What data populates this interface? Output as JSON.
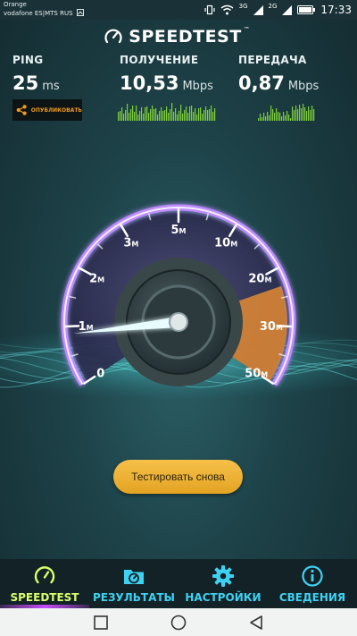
{
  "status_bar": {
    "carrier1": "Orange",
    "carrier2": "vodafone ES|MTS RUS",
    "net1": "3G",
    "net2": "2G",
    "time": "17:33"
  },
  "header": {
    "title": "SPEEDTEST",
    "tm": "™"
  },
  "metrics": {
    "ping": {
      "label": "PING",
      "value": "25",
      "unit": "ms"
    },
    "download": {
      "label": "ПОЛУЧЕНИЕ",
      "value": "10,53",
      "unit": "Mbps"
    },
    "upload": {
      "label": "ПЕРЕДАЧА",
      "value": "0,87",
      "unit": "Mbps"
    }
  },
  "share_button": {
    "label": "ОПУБЛИКОВАТЬ",
    "accent": "#f29b1c"
  },
  "gauge": {
    "ticks": [
      "0",
      "1M",
      "2M",
      "3M",
      "5M",
      "10M",
      "20M",
      "30M",
      "50M"
    ],
    "needle_value_mbps": 0.87,
    "colors": {
      "ring": "#bd8cff",
      "accent": "#e38a33",
      "tick": "#ffffff"
    }
  },
  "test_again_button": {
    "label": "Тестировать снова",
    "color": "#f0b536"
  },
  "nav": {
    "items": [
      {
        "label": "SPEEDTEST",
        "icon": "gauge-icon"
      },
      {
        "label": "РЕЗУЛЬТАТЫ",
        "icon": "results-folder-icon"
      },
      {
        "label": "НАСТРОЙКИ",
        "icon": "gear-icon"
      },
      {
        "label": "СВЕДЕНИЯ",
        "icon": "info-icon"
      }
    ],
    "active_color": "#d9ff6b",
    "color": "#3ed1f2"
  }
}
